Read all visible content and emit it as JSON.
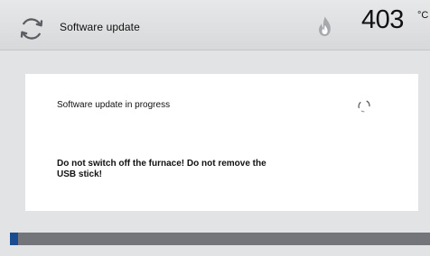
{
  "header": {
    "refresh_icon": "refresh-icon",
    "title": "Software update",
    "flame_icon": "flame-icon",
    "temperature": "403",
    "unit": "°C"
  },
  "main": {
    "status": "Software update in progress",
    "spinner_icon": "spinner-icon",
    "warning_line_1": "Do not switch off the furnace! Do not remove the",
    "warning_line_2": "USB stick!"
  },
  "progress": {
    "value": 0.02,
    "fill_color": "#1a4d8f",
    "track_color": "#73757a"
  },
  "colors": {
    "background": "#e2e3e5",
    "panel": "#ffffff",
    "text": "#111111"
  }
}
